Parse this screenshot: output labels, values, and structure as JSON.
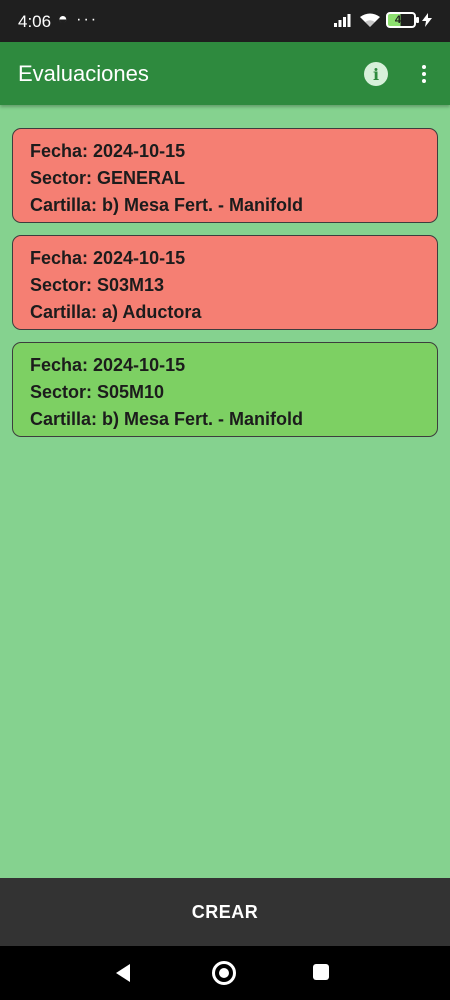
{
  "status_bar": {
    "time": "4:06",
    "left_icons": "◓ ···",
    "battery_level": "48",
    "icons": [
      "signal-icon",
      "wifi-icon",
      "battery-icon",
      "charging-icon"
    ]
  },
  "app_bar": {
    "title": "Evaluaciones",
    "info_glyph": "i",
    "colors": {
      "app_bar": "#2e8a3e",
      "background": "#85d28f"
    }
  },
  "evaluations": [
    {
      "fecha": "Fecha: 2024-10-15",
      "sector": "Sector: GENERAL",
      "cartilla": "Cartilla: b) Mesa Fert. - Manifold",
      "status_color": "#f57f73"
    },
    {
      "fecha": "Fecha: 2024-10-15",
      "sector": "Sector: S03M13",
      "cartilla": "Cartilla: a) Aductora",
      "status_color": "#f57f73"
    },
    {
      "fecha": "Fecha: 2024-10-15",
      "sector": "Sector: S05M10",
      "cartilla": "Cartilla: b) Mesa Fert. - Manifold",
      "status_color": "#7dd063"
    }
  ],
  "bottom": {
    "create_label": "CREAR"
  },
  "navigation": {
    "icons": [
      "back-icon",
      "home-icon",
      "recents-icon"
    ]
  }
}
